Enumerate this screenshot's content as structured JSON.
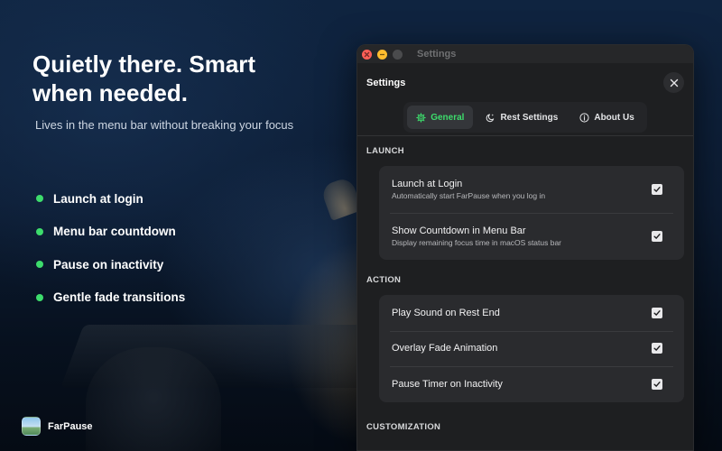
{
  "hero": {
    "title": "Quietly there. Smart when needed.",
    "subtitle": "Lives in the menu bar without breaking your focus"
  },
  "features": [
    "Launch at login",
    "Menu bar countdown",
    "Pause on inactivity",
    "Gentle fade transitions"
  ],
  "brand": {
    "name": "FarPause"
  },
  "window": {
    "title": "Settings",
    "page_title": "Settings",
    "tabs": [
      {
        "label": "General",
        "icon": "gear-icon",
        "active": true
      },
      {
        "label": "Rest Settings",
        "icon": "moon-icon",
        "active": false
      },
      {
        "label": "About Us",
        "icon": "info-icon",
        "active": false
      }
    ],
    "sections": {
      "launch": {
        "label": "LAUNCH",
        "rows": [
          {
            "title": "Launch at Login",
            "desc": "Automatically start FarPause when you log in",
            "checked": true
          },
          {
            "title": "Show Countdown in Menu Bar",
            "desc": "Display remaining focus time in macOS status bar",
            "checked": true
          }
        ]
      },
      "action": {
        "label": "ACTION",
        "rows": [
          {
            "title": "Play Sound on Rest End",
            "checked": true
          },
          {
            "title": "Overlay Fade Animation",
            "checked": true
          },
          {
            "title": "Pause Timer on Inactivity",
            "checked": true
          }
        ]
      },
      "customization": {
        "label": "CUSTOMIZATION"
      }
    }
  },
  "colors": {
    "accent": "#3ddc6c",
    "window_bg": "#1e1f21",
    "card_bg": "#2a2b2e"
  }
}
